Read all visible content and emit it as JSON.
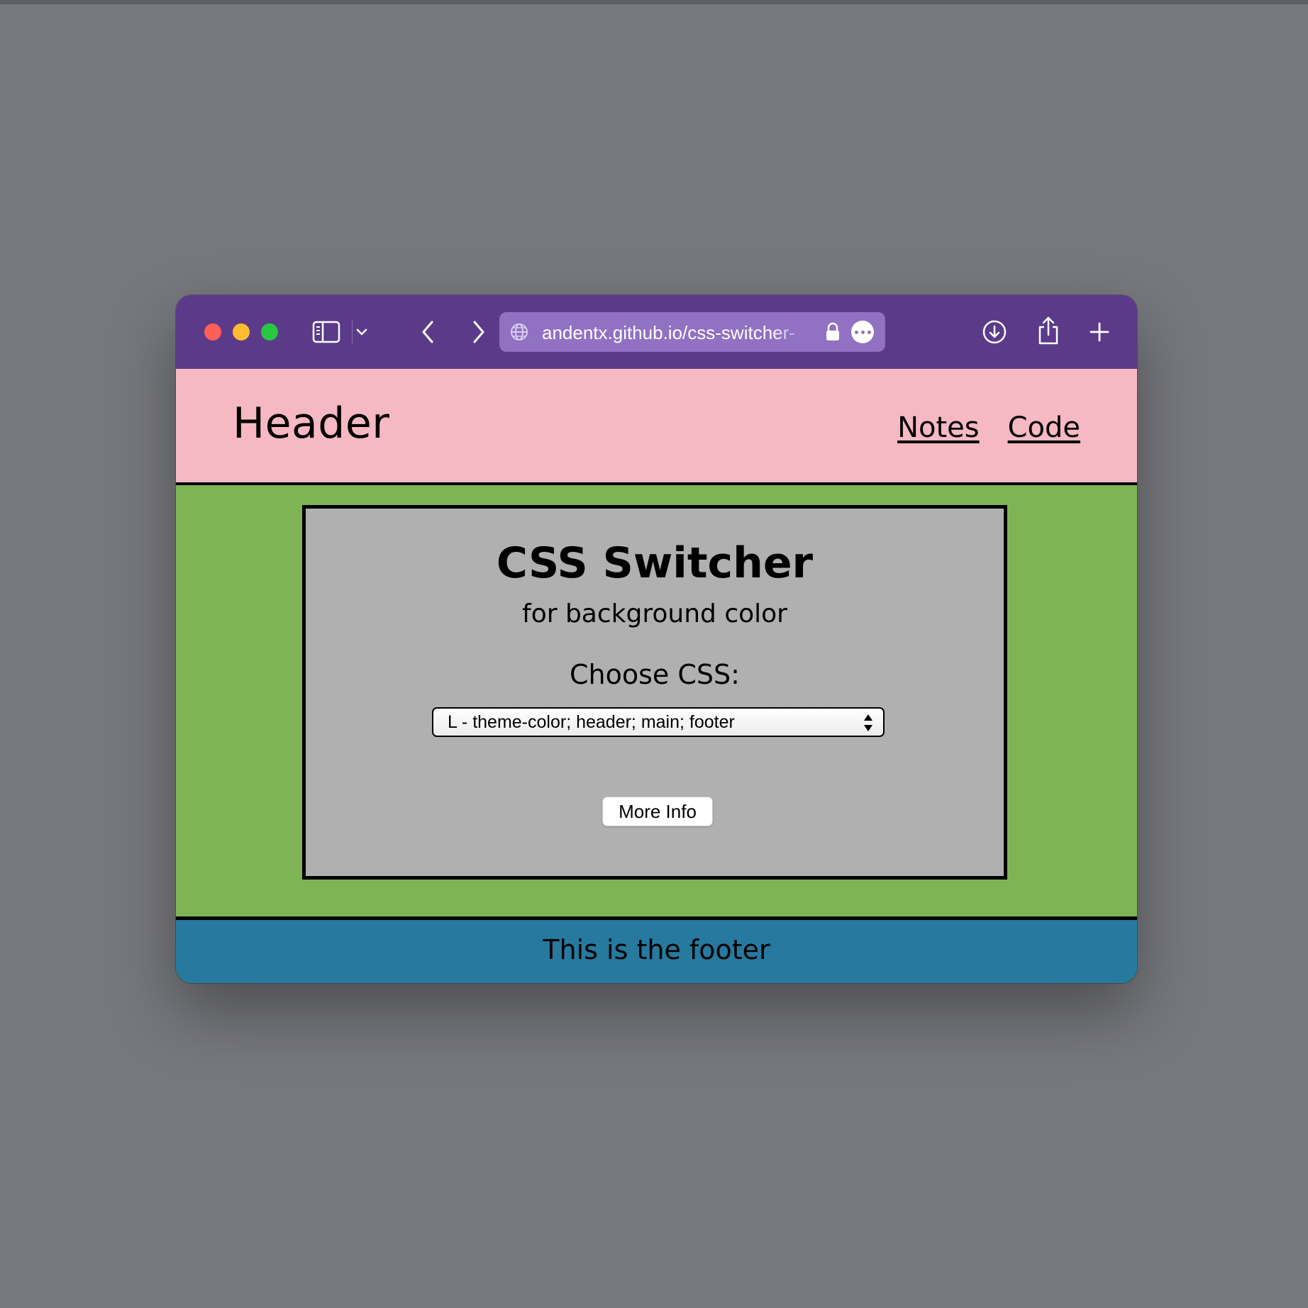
{
  "browser": {
    "url": "andentx.github.io/css-switcher-",
    "toolbar_color": "#5c3a8a",
    "address_bar_color": "#9071c2",
    "icons": [
      "sidebar-icon",
      "chevron-down-icon",
      "back-arrow-icon",
      "forward-arrow-icon",
      "globe-icon",
      "lock-icon",
      "more-icon",
      "download-icon",
      "share-icon",
      "plus-icon"
    ]
  },
  "page": {
    "header": {
      "title": "Header",
      "background": "#f6b8c3",
      "nav": [
        {
          "label": "Notes"
        },
        {
          "label": "Code"
        }
      ]
    },
    "main": {
      "background": "#7fb455",
      "card": {
        "title": "CSS Switcher",
        "subtitle": "for background color",
        "choose_label": "Choose CSS:",
        "select_value": "L - theme-color; header; main; footer",
        "button_label": "More Info",
        "background": "#b0b0b0"
      }
    },
    "footer": {
      "text": "This is the footer",
      "background": "#27799e"
    }
  }
}
